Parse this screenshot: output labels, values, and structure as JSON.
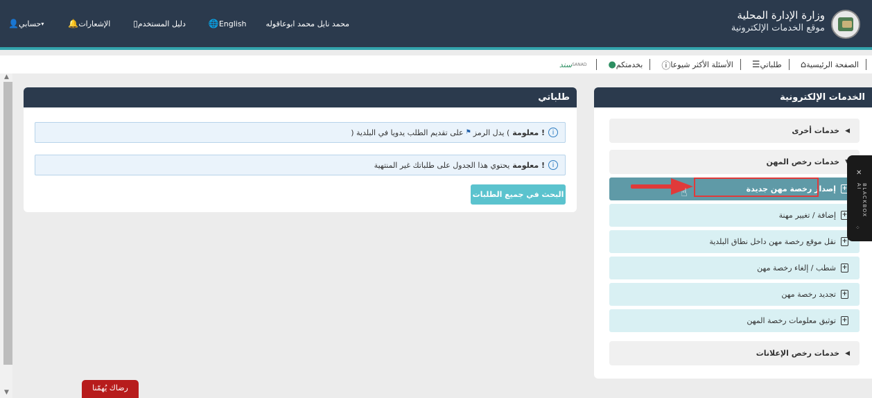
{
  "brand": {
    "title": "وزارة الإدارة المحلية",
    "subtitle": "موقع الخدمات الإلكترونية"
  },
  "topnav": {
    "user_name": "محمد نايل محمد ابوعاقوله",
    "language": "English",
    "user_guide": "دليل المستخدم",
    "notifications": "الإشعارات",
    "account": "حسابي"
  },
  "subnav": {
    "home": "الصفحة الرئيسية",
    "my_requests": "طلباتي",
    "faq": "الأسئلة الأكثر شيوعا",
    "at_service": "بخدمتكم",
    "sanad": "سند",
    "sanad_sub": "SANAD"
  },
  "left_panel": {
    "title": "طلباتي",
    "info1_bold": "معلومة !",
    "info1_text_a": "يدل الرمز (",
    "info1_text_b": ") على تقديم الطلب يدويا في البلدية",
    "info2_bold": "معلومة !",
    "info2_text": "يحتوي هذا الجدول على طلباتك غير المنتهية",
    "search_button": "البحث في جميع الطلبات"
  },
  "right_panel": {
    "title": "الخدمات الإلكترونية",
    "other_services": "خدمات أخرى",
    "profession_licenses": "خدمات رخص المهن",
    "ads_licenses": "خدمات رخص الإعلانات",
    "services": [
      "إصدار رخصة مهن جديدة",
      "إضافة / تغيير مهنة",
      "نقل موقع رخصة مهن داخل نطاق البلدية",
      "شطب / إلغاء رخصة مهن",
      "تجديد رخصة مهن",
      "توثيق معلومات رخصة المهن"
    ]
  },
  "blackbox": {
    "label": "BLACKBOX AI"
  },
  "feedback": {
    "label": "رضاك يُهمّنا"
  },
  "colors": {
    "header": "#2b3a4d",
    "accent": "#33a4ad",
    "service_bg": "#d9f0f3",
    "service_active": "#5f9aa7",
    "search_button": "#5bc3ce",
    "highlight": "#e03a3a",
    "feedback": "#b71c1c"
  }
}
